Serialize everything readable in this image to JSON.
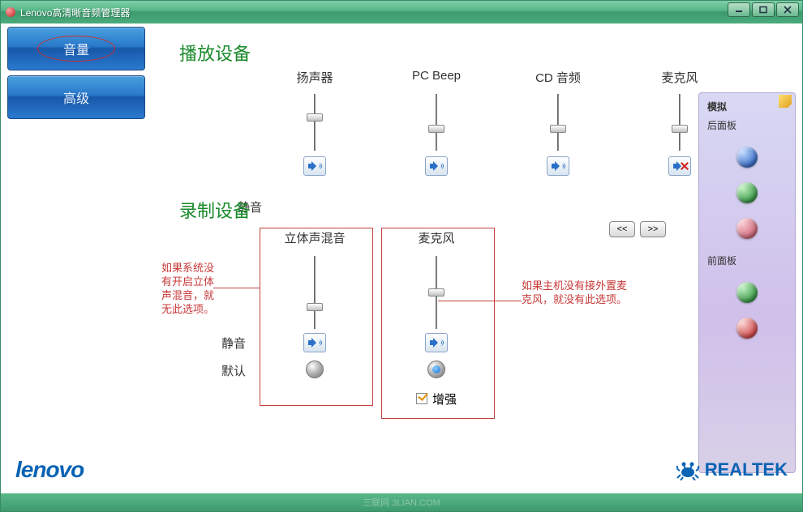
{
  "window": {
    "title": "Lenovo高清晰音频管理器"
  },
  "sidebar": {
    "volume": "音量",
    "advanced": "高级"
  },
  "playback": {
    "title": "播放设备",
    "mute_label": "静音",
    "devices": [
      {
        "name": "扬声器",
        "level": 55,
        "muted": false
      },
      {
        "name": "PC Beep",
        "level": 35,
        "muted": false
      },
      {
        "name": "CD 音频",
        "level": 35,
        "muted": false
      },
      {
        "name": "麦克风",
        "level": 35,
        "muted": true
      }
    ],
    "nav_prev": "<<",
    "nav_next": ">>"
  },
  "record": {
    "title": "录制设备",
    "mute_label": "静音",
    "default_label": "默认",
    "enhance_label": "增强",
    "devices": [
      {
        "name": "立体声混音",
        "level": 30,
        "muted": false,
        "default": false,
        "enhance": null
      },
      {
        "name": "麦克风",
        "level": 50,
        "muted": false,
        "default": true,
        "enhance": true
      }
    ]
  },
  "annotations": {
    "stereo_mix": "如果系统没有开启立体声混音，就无此选项。",
    "mic": "如果主机没有接外置麦克风，就没有此选项。"
  },
  "panel": {
    "title": "模拟",
    "rear": "后面板",
    "front": "前面板"
  },
  "brand": {
    "lenovo": "lenovo",
    "realtek": "REALTEK"
  },
  "footer": "三联网 3LIAN.COM"
}
